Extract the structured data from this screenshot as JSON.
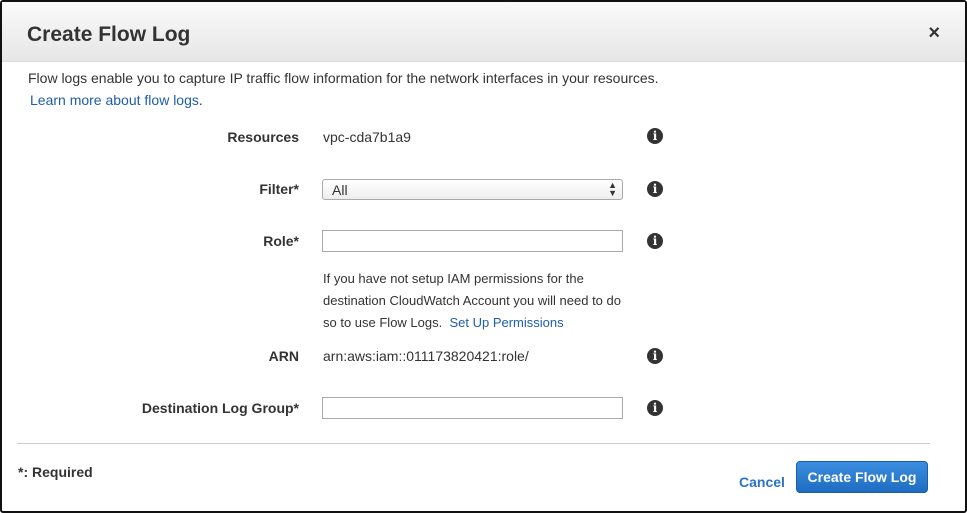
{
  "dialog": {
    "title": "Create Flow Log",
    "close_icon": "×"
  },
  "intro": "Flow logs enable you to capture IP traffic flow information for the network interfaces in your resources.",
  "learn_more": "Learn more about flow logs",
  "learn_more_suffix": ".",
  "form": {
    "resources_label": "Resources",
    "resources_value": "vpc-cda7b1a9",
    "filter_label": "Filter*",
    "filter_value": "All",
    "role_label": "Role*",
    "role_value": "",
    "role_help": "If you have not setup IAM permissions for the destination CloudWatch Account you will need to do so to use Flow Logs.",
    "set_up_permissions": "Set Up Permissions",
    "arn_label": "ARN",
    "arn_value": "arn:aws:iam::011173820421:role/",
    "dest_label": "Destination Log Group*",
    "dest_value": ""
  },
  "footer": {
    "required": "*: Required",
    "cancel": "Cancel",
    "create": "Create Flow Log"
  },
  "colors": {
    "primary": "#2a73c5",
    "link": "#1f5ea8"
  }
}
